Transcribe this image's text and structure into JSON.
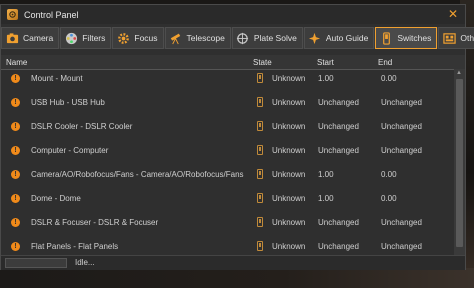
{
  "window": {
    "title": "Control Panel",
    "close_icon": "close-icon"
  },
  "tabs": [
    {
      "label": "Camera",
      "icon": "camera-icon"
    },
    {
      "label": "Filters",
      "icon": "filter-wheel-icon"
    },
    {
      "label": "Focus",
      "icon": "gear-icon"
    },
    {
      "label": "Telescope",
      "icon": "telescope-icon"
    },
    {
      "label": "Plate Solve",
      "icon": "crosshair-icon"
    },
    {
      "label": "Auto Guide",
      "icon": "guide-icon"
    },
    {
      "label": "Switches",
      "icon": "switch-icon",
      "active": true
    },
    {
      "label": "Other",
      "icon": "other-icon"
    }
  ],
  "columns": {
    "name": "Name",
    "state": "State",
    "start": "Start",
    "end": "End"
  },
  "rows": [
    {
      "name": "Mount - Mount",
      "state": "Unknown",
      "start": "1.00",
      "end": "0.00"
    },
    {
      "name": "USB Hub - USB Hub",
      "state": "Unknown",
      "start": "Unchanged",
      "end": "Unchanged"
    },
    {
      "name": "DSLR Cooler - DSLR Cooler",
      "state": "Unknown",
      "start": "Unchanged",
      "end": "Unchanged"
    },
    {
      "name": "Computer - Computer",
      "state": "Unknown",
      "start": "Unchanged",
      "end": "Unchanged"
    },
    {
      "name": "Camera/AO/Robofocus/Fans - Camera/AO/Robofocus/Fans",
      "state": "Unknown",
      "start": "1.00",
      "end": "0.00"
    },
    {
      "name": "Dome - Dome",
      "state": "Unknown",
      "start": "1.00",
      "end": "0.00"
    },
    {
      "name": "DSLR & Focuser - DSLR & Focuser",
      "state": "Unknown",
      "start": "Unchanged",
      "end": "Unchanged"
    },
    {
      "name": "Flat Panels - Flat Panels",
      "state": "Unknown",
      "start": "Unchanged",
      "end": "Unchanged"
    }
  ],
  "status": {
    "text": "Idle..."
  },
  "colors": {
    "accent": "#f0a030",
    "warning": "#f08a1a"
  }
}
